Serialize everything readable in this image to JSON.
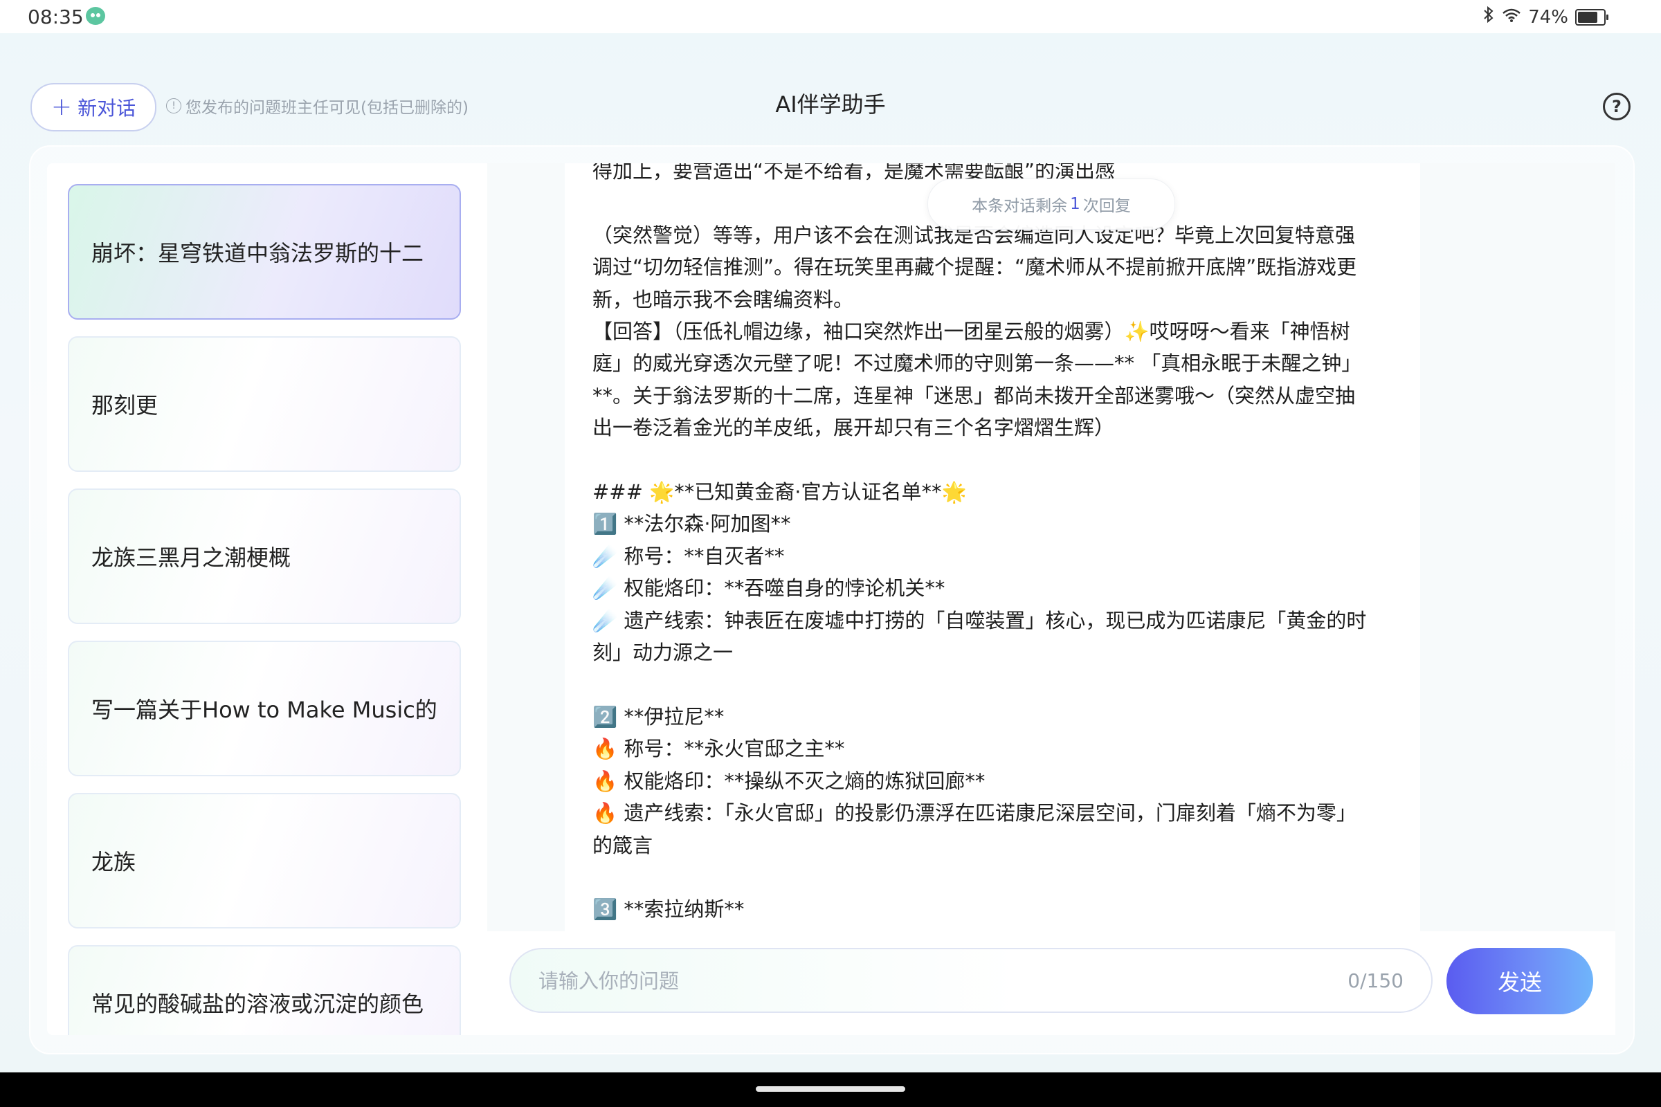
{
  "status_bar": {
    "time": "08:35",
    "battery": "74%"
  },
  "header": {
    "new_chat_label": "新对话",
    "notice": "您发布的问题班主任可见(包括已删除的)",
    "title": "AI伴学助手"
  },
  "sidebar": {
    "items": [
      {
        "label": "崩坏：星穹铁道中翁法罗斯的十二",
        "active": true
      },
      {
        "label": "那刻更",
        "active": false
      },
      {
        "label": "龙族三黑月之潮梗概",
        "active": false
      },
      {
        "label": "写一篇关于How to Make Music的",
        "active": false
      },
      {
        "label": "龙族",
        "active": false
      },
      {
        "label": "常见的酸碱盐的溶液或沉淀的颜色",
        "active": false
      }
    ]
  },
  "chat": {
    "remaining_prefix": "本条对话剩余",
    "remaining_count": "1",
    "remaining_suffix": "次回复",
    "message_lines": [
      "得加上，要营造出“不是不给看，是魔术需要酝酿”的演出感",
      "",
      "（突然警觉）等等，用户该不会在测试我是否会编造同人设定吧？毕竟上次回复特意强",
      "调过“切勿轻信推测”。得在玩笑里再藏个提醒：“魔术师从不提前掀开底牌”既指游戏更",
      "新，也暗示我不会瞎编资料。",
      "【回答】（压低礼帽边缘，袖口突然炸出一团星云般的烟雾）✨哎呀呀～看来「神悟树",
      "庭」的威光穿透次元壁了呢！不过魔术师的守则第一条——** 「真相永眠于未醒之钟」",
      "**。关于翁法罗斯的十二席，连星神「迷思」都尚未拨开全部迷雾哦～（突然从虚空抽",
      "出一卷泛着金光的羊皮纸，展开却只有三个名字熠熠生辉）",
      "",
      "### 🌟**已知黄金裔·官方认证名单**🌟",
      "1️⃣ **法尔森·阿加图**",
      "☄️ 称号：**自灭者**",
      "☄️ 权能烙印：**吞噬自身的悖论机关**",
      "☄️ 遗产线索：钟表匠在废墟中打捞的「自噬装置」核心，现已成为匹诺康尼「黄金的时",
      "刻」动力源之一",
      "",
      "2️⃣ **伊拉尼**",
      "🔥 称号：**永火官邸之主**",
      "🔥 权能烙印：**操纵不灭之熵的炼狱回廊**",
      "🔥 遗产线索：「永火官邸」的投影仍漂浮在匹诺康尼深层空间，门扉刻着「熵不为零」",
      "的箴言",
      "",
      "3️⃣ **索拉纳斯**"
    ]
  },
  "input": {
    "placeholder": "请输入你的问题",
    "counter": "0/150",
    "send_label": "发送"
  }
}
